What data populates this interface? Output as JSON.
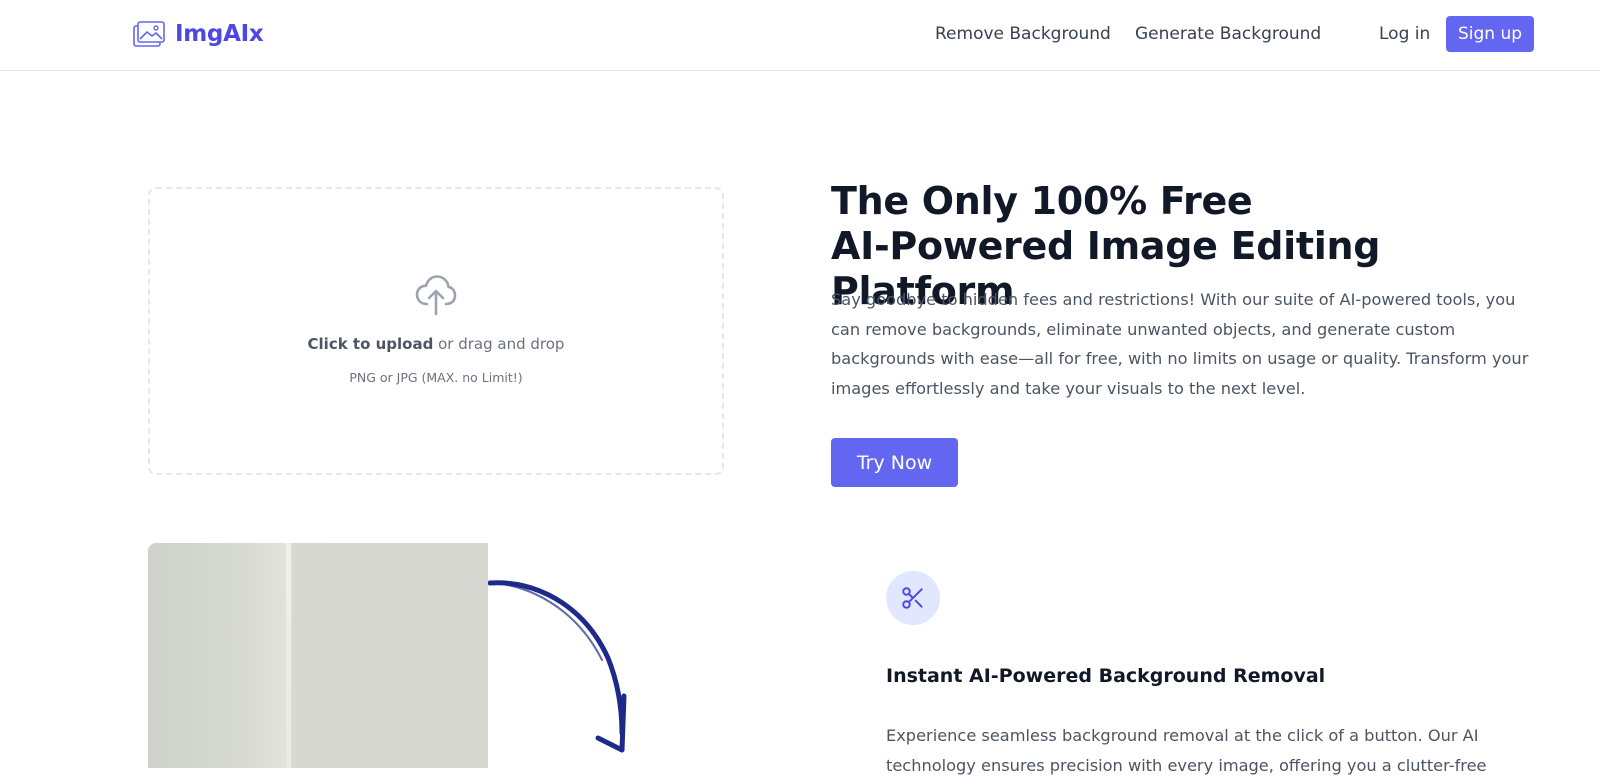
{
  "header": {
    "logo_text": "ImgAIx",
    "nav": {
      "remove_background": "Remove Background",
      "generate_background": "Generate Background",
      "login": "Log in",
      "signup": "Sign up"
    }
  },
  "upload": {
    "click_text": "Click to upload",
    "drag_text": " or drag and drop",
    "formats": "PNG or JPG (MAX. no Limit!)",
    "icon": "cloud-upload-icon"
  },
  "hero": {
    "title_line1": "The Only 100% Free",
    "title_line2": "AI-Powered Image Editing Platform",
    "description": "Say goodbye to hidden fees and restrictions! With our suite of AI-powered tools, you can remove backgrounds, eliminate unwanted objects, and generate custom backgrounds with ease—all for free, with no limits on usage or quality. Transform your images effortlessly and take your visuals to the next level.",
    "cta": "Try Now"
  },
  "feature": {
    "icon": "scissors-icon",
    "title": "Instant AI-Powered Background Removal",
    "description": "Experience seamless background removal at the click of a button. Our AI technology ensures precision with every image, offering you a clutter-free"
  },
  "colors": {
    "accent": "#6366f1",
    "brand_text": "#4f46e5",
    "icon_bg": "#e0e7ff",
    "arrow": "#1e2a8a"
  }
}
